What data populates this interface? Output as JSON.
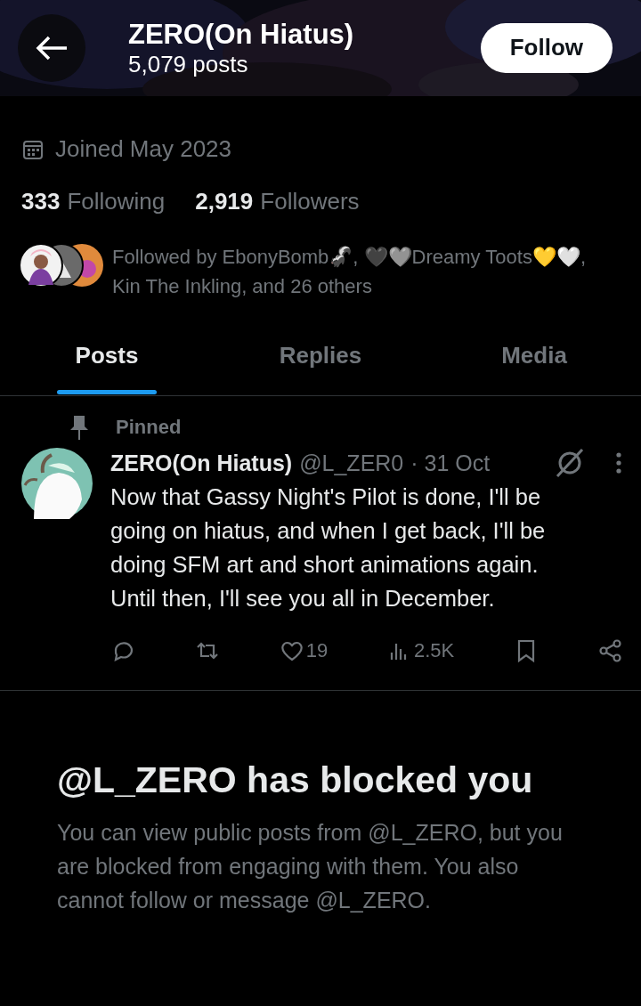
{
  "header": {
    "title": "ZERO(On Hiatus)",
    "post_count": "5,079 posts",
    "follow_button": "Follow"
  },
  "profile": {
    "joined": "Joined May 2023",
    "stats": [
      {
        "count": "333",
        "label": "Following"
      },
      {
        "count": "2,919",
        "label": "Followers"
      }
    ],
    "followed_by": "Followed by EbonyBomb🦨, 🖤🩶Dreamy Toots💛🤍, Kin The Inkling, and 26 others"
  },
  "tabs": [
    {
      "label": "Posts",
      "selected": true
    },
    {
      "label": "Replies",
      "selected": false
    },
    {
      "label": "Media",
      "selected": false
    }
  ],
  "pinned_post": {
    "pinned_label": "Pinned",
    "author": "ZERO(On Hiatus)",
    "handle": "@L_ZER0",
    "date": "· 31 Oct",
    "text": "Now that Gassy Night's Pilot is done, I'll be going on hiatus, and when I get back, I'll be doing SFM art and short animations again. Until then, I'll see you all in December.",
    "actions": [
      {
        "kind": "reply"
      },
      {
        "kind": "repost"
      },
      {
        "kind": "like",
        "count": "19"
      },
      {
        "kind": "views",
        "count": "2.5K"
      },
      {
        "kind": "bookmark"
      },
      {
        "kind": "share"
      }
    ]
  },
  "blocked": {
    "heading": "@L_ZERO has blocked you",
    "message": "You can view public posts from @L_ZERO, but you are blocked from engaging with them. You also cannot follow or message @L_ZERO."
  }
}
